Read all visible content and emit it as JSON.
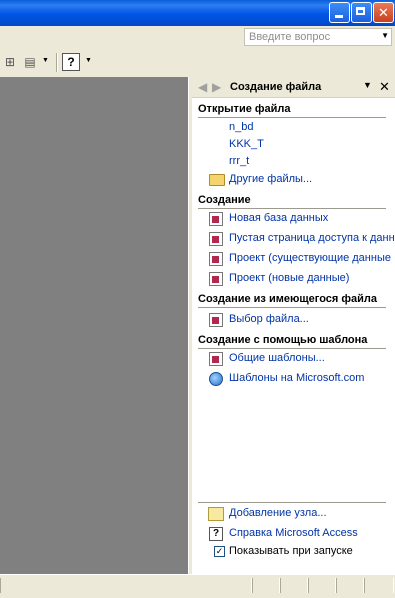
{
  "window": {
    "buttons": [
      "minimize",
      "maximize",
      "close"
    ]
  },
  "help_search": {
    "placeholder": "Введите вопрос"
  },
  "task_pane": {
    "title": "Создание файла",
    "open_section": {
      "title": "Открытие файла",
      "files": [
        "n_bd",
        "KKK_T",
        "rrr_t"
      ],
      "more_files": "Другие файлы..."
    },
    "create_section": {
      "title": "Создание",
      "items": [
        "Новая база данных",
        "Пустая страница доступа к данн",
        "Проект (существующие данные",
        "Проект (новые данные)"
      ]
    },
    "from_existing_section": {
      "title": "Создание из имеющегося файла",
      "items": [
        "Выбор файла..."
      ]
    },
    "templates_section": {
      "title": "Создание с помощью шаблона",
      "items": [
        "Общие шаблоны...",
        "Шаблоны на Microsoft.com"
      ]
    },
    "footer": {
      "add_node": "Добавление узла...",
      "help": "Справка Microsoft Access",
      "show_on_startup": "Показывать при запуске",
      "show_on_startup_checked": true
    }
  }
}
